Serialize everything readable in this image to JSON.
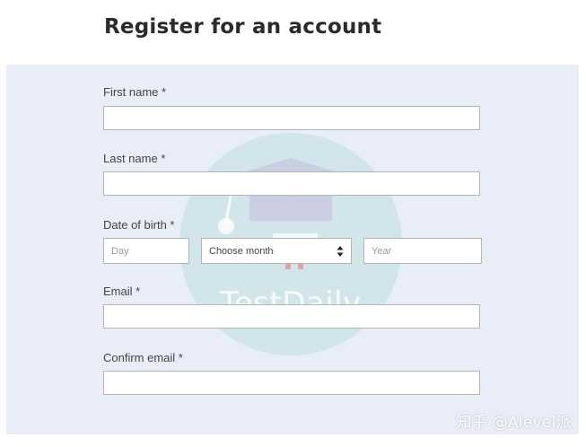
{
  "page": {
    "title": "Register for an account"
  },
  "form": {
    "first_name": {
      "label": "First name *",
      "value": ""
    },
    "last_name": {
      "label": "Last name *",
      "value": ""
    },
    "date_of_birth": {
      "label": "Date of birth *",
      "day_placeholder": "Day",
      "month_selected": "Choose month",
      "year_placeholder": "Year"
    },
    "email": {
      "label": "Email *",
      "value": ""
    },
    "confirm_email": {
      "label": "Confirm email *",
      "value": ""
    }
  },
  "watermark": {
    "text": "TestDaily",
    "icon": "graduation-cap-icon"
  },
  "credit": {
    "text": "知乎 @Alevel派"
  },
  "colors": {
    "panel_background": "#e8edf7",
    "input_border": "#b4b4b4",
    "title_text": "#2b2b2b"
  }
}
